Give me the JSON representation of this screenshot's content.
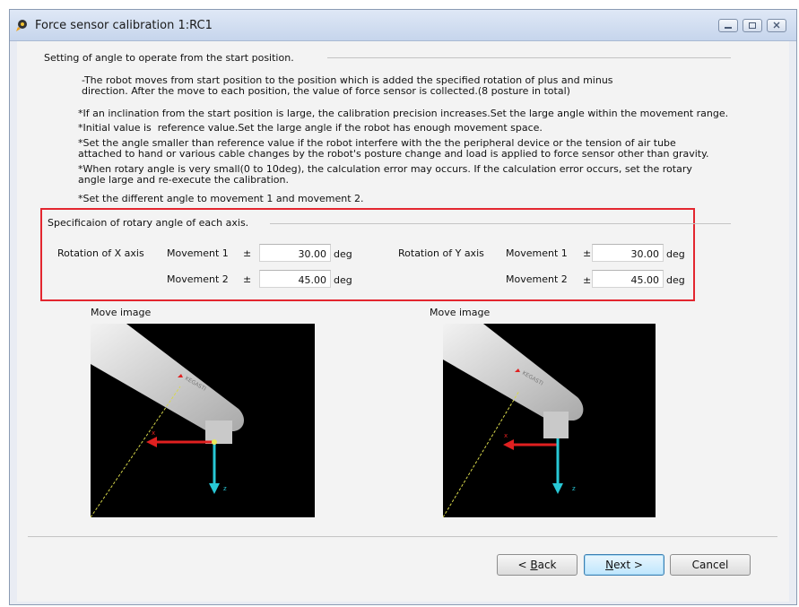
{
  "window": {
    "title": "Force sensor calibration 1:RC1"
  },
  "section1": {
    "header": "Setting of angle to operate from the start position.",
    "desc1": "-The robot moves from start position to the position which is added the specified rotation of plus and minus",
    "desc2": "direction. After the move to each position, the value of force sensor is collected.(8 posture in total)",
    "note1": "*If an inclination from the start position is large, the calibration precision increases.Set the large angle within the movement range.",
    "note2": "*Initial value is  reference value.Set the large angle if the robot has enough movement space.",
    "note3a": "*Set the angle smaller than reference value if the robot interfere with the the peripheral device or the tension of air tube",
    "note3b": "attached to hand or various cable changes by the robot's posture change and load is applied to force sensor other than gravity.",
    "note4a": "*When rotary angle is very small(0 to 10deg), the calculation error may occurs. If the calculation error occurs, set the rotary",
    "note4b": "angle large and re-execute the calibration.",
    "note5": "*Set the different angle to movement 1 and movement 2."
  },
  "spec": {
    "header": "Specificaion of rotary angle of each axis.",
    "x_axis": {
      "label": "Rotation of X axis",
      "m1_label": "Movement 1",
      "m1_sign": "±",
      "m1_value": "30.00",
      "m1_unit": "deg",
      "m2_label": "Movement 2",
      "m2_sign": "±",
      "m2_value": "45.00",
      "m2_unit": "deg"
    },
    "y_axis": {
      "label": "Rotation of Y axis",
      "m1_label": "Movement 1",
      "m1_sign": "±",
      "m1_value": "30.00",
      "m1_unit": "deg",
      "m2_label": "Movement 2",
      "m2_sign": "±",
      "m2_value": "45.00",
      "m2_unit": "deg"
    }
  },
  "images": {
    "left_label": "Move image",
    "right_label": "Move image",
    "axis_x": "x",
    "axis_z": "z",
    "brand_text": "KEGASTI"
  },
  "buttons": {
    "back_prefix": "< ",
    "back_mnemonic": "B",
    "back_rest": "ack",
    "next_mnemonic": "N",
    "next_rest": "ext >",
    "cancel": "Cancel"
  },
  "colors": {
    "highlight": "#e3262f",
    "arrow_x": "#e02020",
    "arrow_z": "#28c8d6",
    "dash_line": "#d8d84a"
  }
}
